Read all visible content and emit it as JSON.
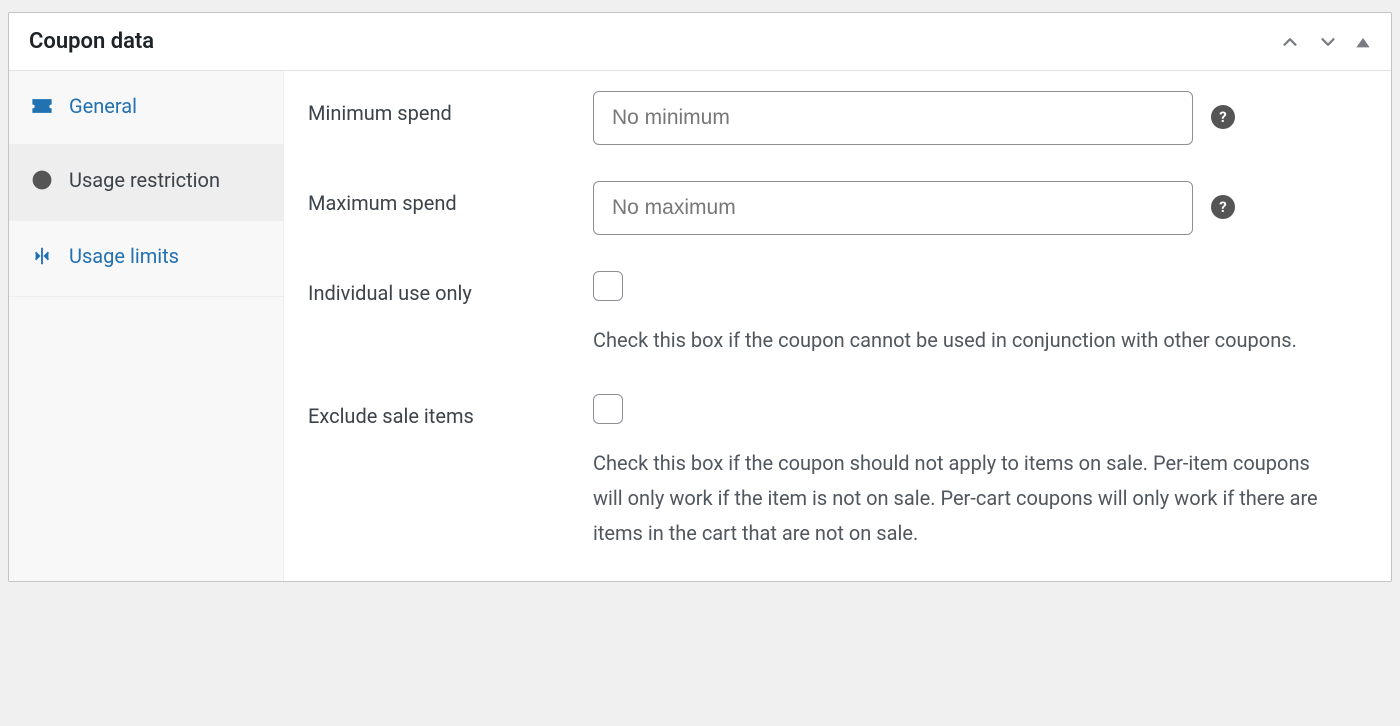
{
  "panel": {
    "title": "Coupon data"
  },
  "tabs": [
    {
      "id": "general",
      "label": "General",
      "active": false
    },
    {
      "id": "usage-restriction",
      "label": "Usage restriction",
      "active": true
    },
    {
      "id": "usage-limits",
      "label": "Usage limits",
      "active": false
    }
  ],
  "fields": {
    "minimum_spend": {
      "label": "Minimum spend",
      "placeholder": "No minimum",
      "value": ""
    },
    "maximum_spend": {
      "label": "Maximum spend",
      "placeholder": "No maximum",
      "value": ""
    },
    "individual_use": {
      "label": "Individual use only",
      "checked": false,
      "description": "Check this box if the coupon cannot be used in conjunction with other coupons."
    },
    "exclude_sale": {
      "label": "Exclude sale items",
      "checked": false,
      "description": "Check this box if the coupon should not apply to items on sale. Per-item coupons will only work if the item is not on sale. Per-cart coupons will only work if there are items in the cart that are not on sale."
    }
  }
}
